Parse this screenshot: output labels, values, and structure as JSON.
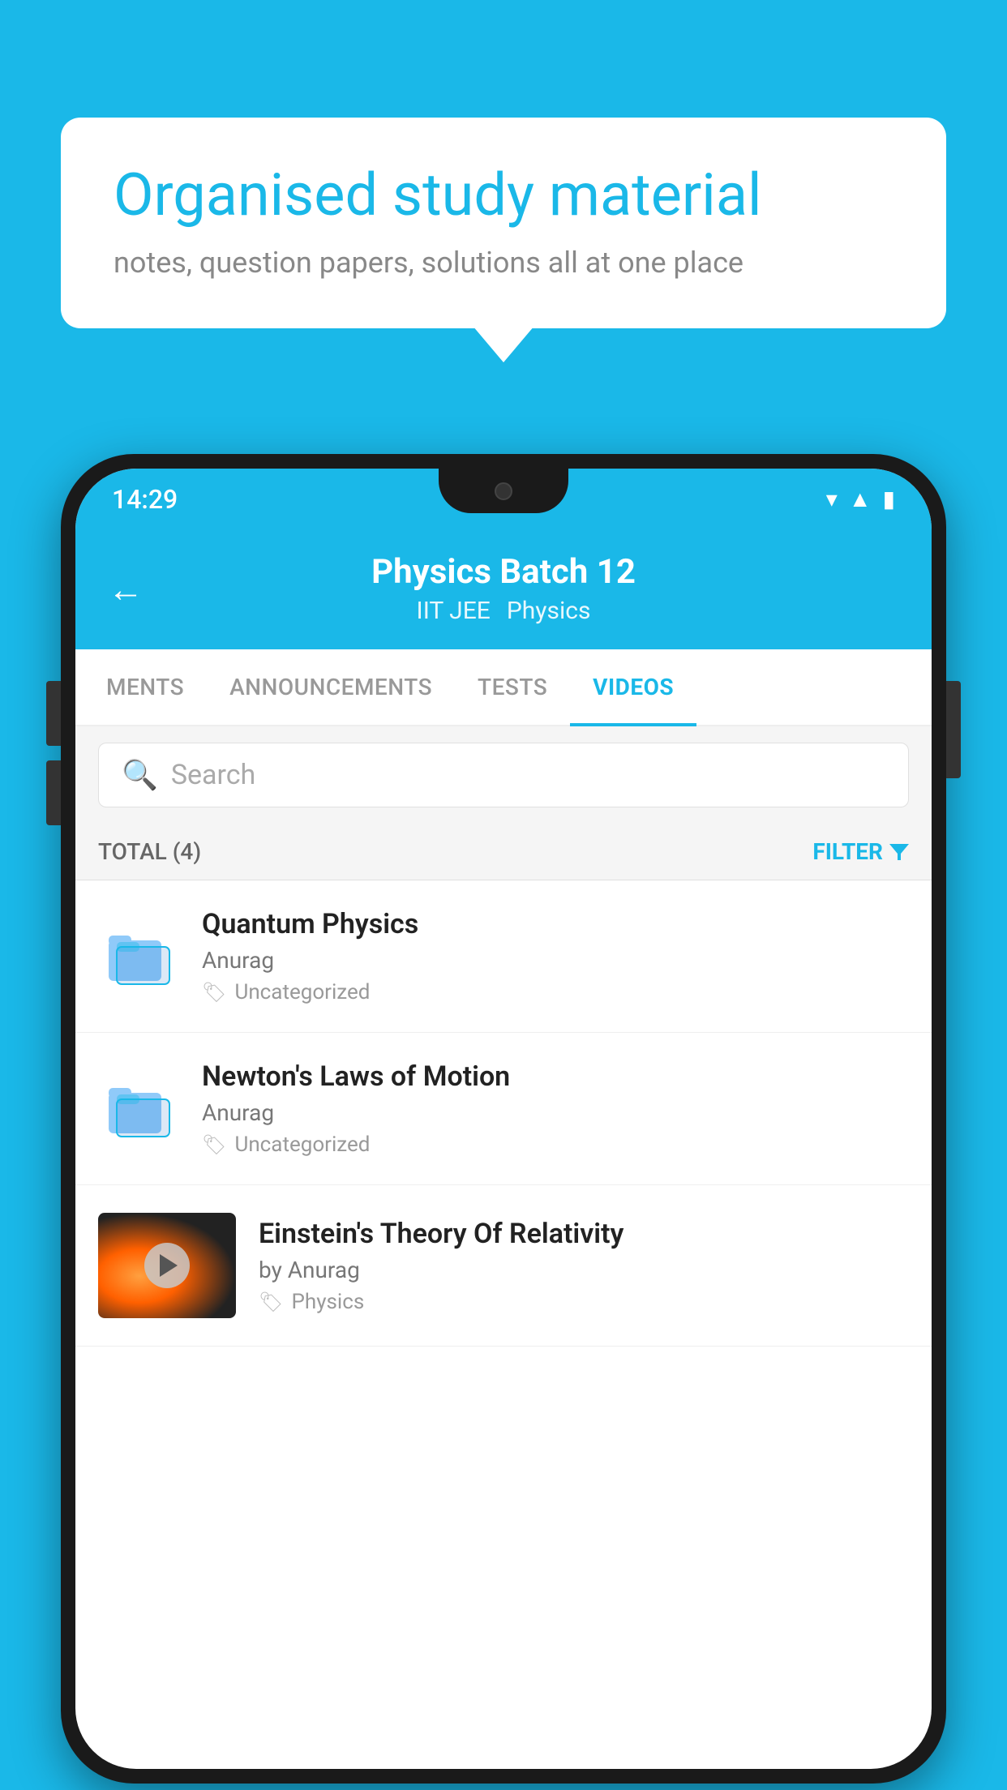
{
  "background_color": "#1ab8e8",
  "bubble": {
    "title": "Organised study material",
    "subtitle": "notes, question papers, solutions all at one place"
  },
  "phone": {
    "status_bar": {
      "time": "14:29"
    },
    "header": {
      "title": "Physics Batch 12",
      "subtitle_part1": "IIT JEE",
      "subtitle_part2": "Physics",
      "back_icon": "←"
    },
    "tabs": [
      {
        "label": "MENTS",
        "active": false
      },
      {
        "label": "ANNOUNCEMENTS",
        "active": false
      },
      {
        "label": "TESTS",
        "active": false
      },
      {
        "label": "VIDEOS",
        "active": true
      }
    ],
    "search": {
      "placeholder": "Search"
    },
    "filter_bar": {
      "total_label": "TOTAL (4)",
      "filter_label": "FILTER"
    },
    "videos": [
      {
        "title": "Quantum Physics",
        "author": "Anurag",
        "tag": "Uncategorized",
        "type": "folder"
      },
      {
        "title": "Newton's Laws of Motion",
        "author": "Anurag",
        "tag": "Uncategorized",
        "type": "folder"
      },
      {
        "title": "Einstein's Theory Of Relativity",
        "author": "by Anurag",
        "tag": "Physics",
        "type": "video"
      }
    ]
  }
}
